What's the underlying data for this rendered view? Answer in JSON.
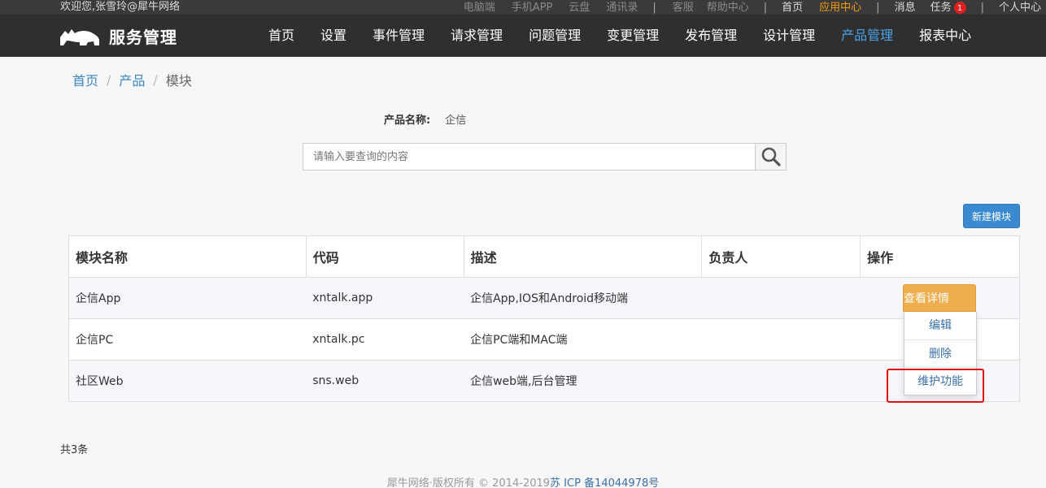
{
  "topbar": {
    "welcome": "欢迎您,张雪玲@犀牛网络",
    "links_muted": [
      "电脑端",
      "手机APP",
      "云盘",
      "通讯录"
    ],
    "links_group2": [
      "客服",
      "帮助中心"
    ],
    "home": "首页",
    "app_center": "应用中心",
    "messages": "消息",
    "tasks": "任务",
    "tasks_badge": "1",
    "personal": "个人中心",
    "separator": "|"
  },
  "header": {
    "brand": "服务管理",
    "nav": [
      "首页",
      "设置",
      "事件管理",
      "请求管理",
      "问题管理",
      "变更管理",
      "发布管理",
      "设计管理",
      "产品管理",
      "报表中心"
    ],
    "active_nav": "产品管理"
  },
  "breadcrumb": {
    "items": [
      "首页",
      "产品"
    ],
    "current": "模块",
    "separator": "/"
  },
  "product": {
    "label": "产品名称:",
    "value": "企信"
  },
  "search": {
    "placeholder": "请输入要查询的内容"
  },
  "toolbar": {
    "new_module": "新建模块"
  },
  "table": {
    "headers": [
      "模块名称",
      "代码",
      "描述",
      "负责人",
      "操作"
    ],
    "rows": [
      {
        "name": "企信App",
        "code": "xntalk.app",
        "desc": "企信App,IOS和Android移动端",
        "owner": ""
      },
      {
        "name": "企信PC",
        "code": "xntalk.pc",
        "desc": "企信PC端和MAC端",
        "owner": ""
      },
      {
        "name": "社区Web",
        "code": "sns.web",
        "desc": "企信web端,后台管理",
        "owner": ""
      }
    ]
  },
  "actions": {
    "view_details": "查看详情",
    "menu": [
      "编辑",
      "删除",
      "维护功能"
    ]
  },
  "footer": {
    "total": "共3条",
    "copyright": "犀牛网络·版权所有 © 2014-2019",
    "icp": "苏 ICP 备14044978号"
  },
  "colors": {
    "accent": "#3a8ad2",
    "active_nav": "#4aa3e8",
    "warning": "#f0ad4e",
    "highlight": "#e01010",
    "app_center": "#f39c12"
  }
}
